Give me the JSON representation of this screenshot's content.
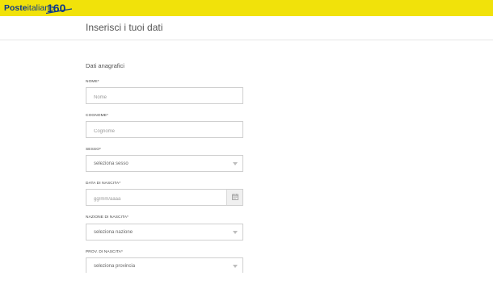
{
  "header": {
    "brand_bold": "Poste",
    "brand_regular": "italiane",
    "badge_text": "160",
    "brand_color": "#0d3a8a",
    "bar_color": "#f1e20a"
  },
  "page": {
    "title": "Inserisci i tuoi dati",
    "section_title": "Dati anagrafici"
  },
  "form": {
    "nome": {
      "label": "NOME*",
      "placeholder": "Nome",
      "value": ""
    },
    "cognome": {
      "label": "COGNOME*",
      "placeholder": "Cognome",
      "value": ""
    },
    "sesso": {
      "label": "SESSO*",
      "selected": "seleziona sesso"
    },
    "data_nascita": {
      "label": "DATA DI NASCITA*",
      "placeholder": "gg/mm/aaaa",
      "value": "",
      "icon": "calendar-icon"
    },
    "nazione_nascita": {
      "label": "NAZIONE DI NASCITA*",
      "selected": "seleziona nazione"
    },
    "prov_nascita": {
      "label": "PROV. DI NASCITA*",
      "selected": "seleziona provincia"
    }
  }
}
